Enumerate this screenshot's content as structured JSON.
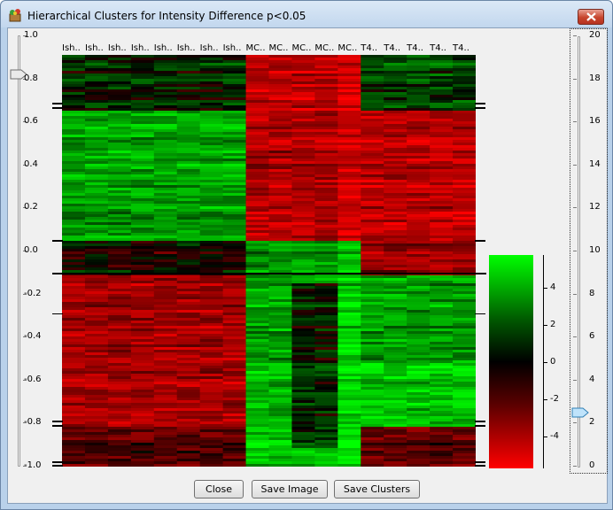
{
  "window": {
    "title": "Hierarchical Clusters for Intensity Difference p<0.05"
  },
  "left_slider": {
    "ticks": [
      "1.0",
      "0.8",
      "0.6",
      "0.4",
      "0.2",
      "0.0",
      "-0.2",
      "-0.4",
      "-0.6",
      "-0.8",
      "-1.0"
    ],
    "value": 0.82
  },
  "right_slider": {
    "ticks": [
      "20",
      "18",
      "16",
      "14",
      "12",
      "10",
      "8",
      "6",
      "4",
      "2",
      "0"
    ],
    "value": 2.5
  },
  "columns": [
    "Ish..",
    "Ish..",
    "Ish..",
    "Ish..",
    "Ish..",
    "Ish..",
    "Ish..",
    "Ish..",
    "MC..",
    "MC..",
    "MC..",
    "MC..",
    "MC..",
    "T4..",
    "T4..",
    "T4..",
    "T4..",
    "T4.."
  ],
  "color_scale": {
    "labels": [
      "4",
      "2",
      "0",
      "-2",
      "-4"
    ],
    "high_color": "#00ff00",
    "mid_color": "#000000",
    "low_color": "#ff0000"
  },
  "buttons": {
    "close": "Close",
    "save_image": "Save Image",
    "save_clusters": "Save Clusters"
  }
}
